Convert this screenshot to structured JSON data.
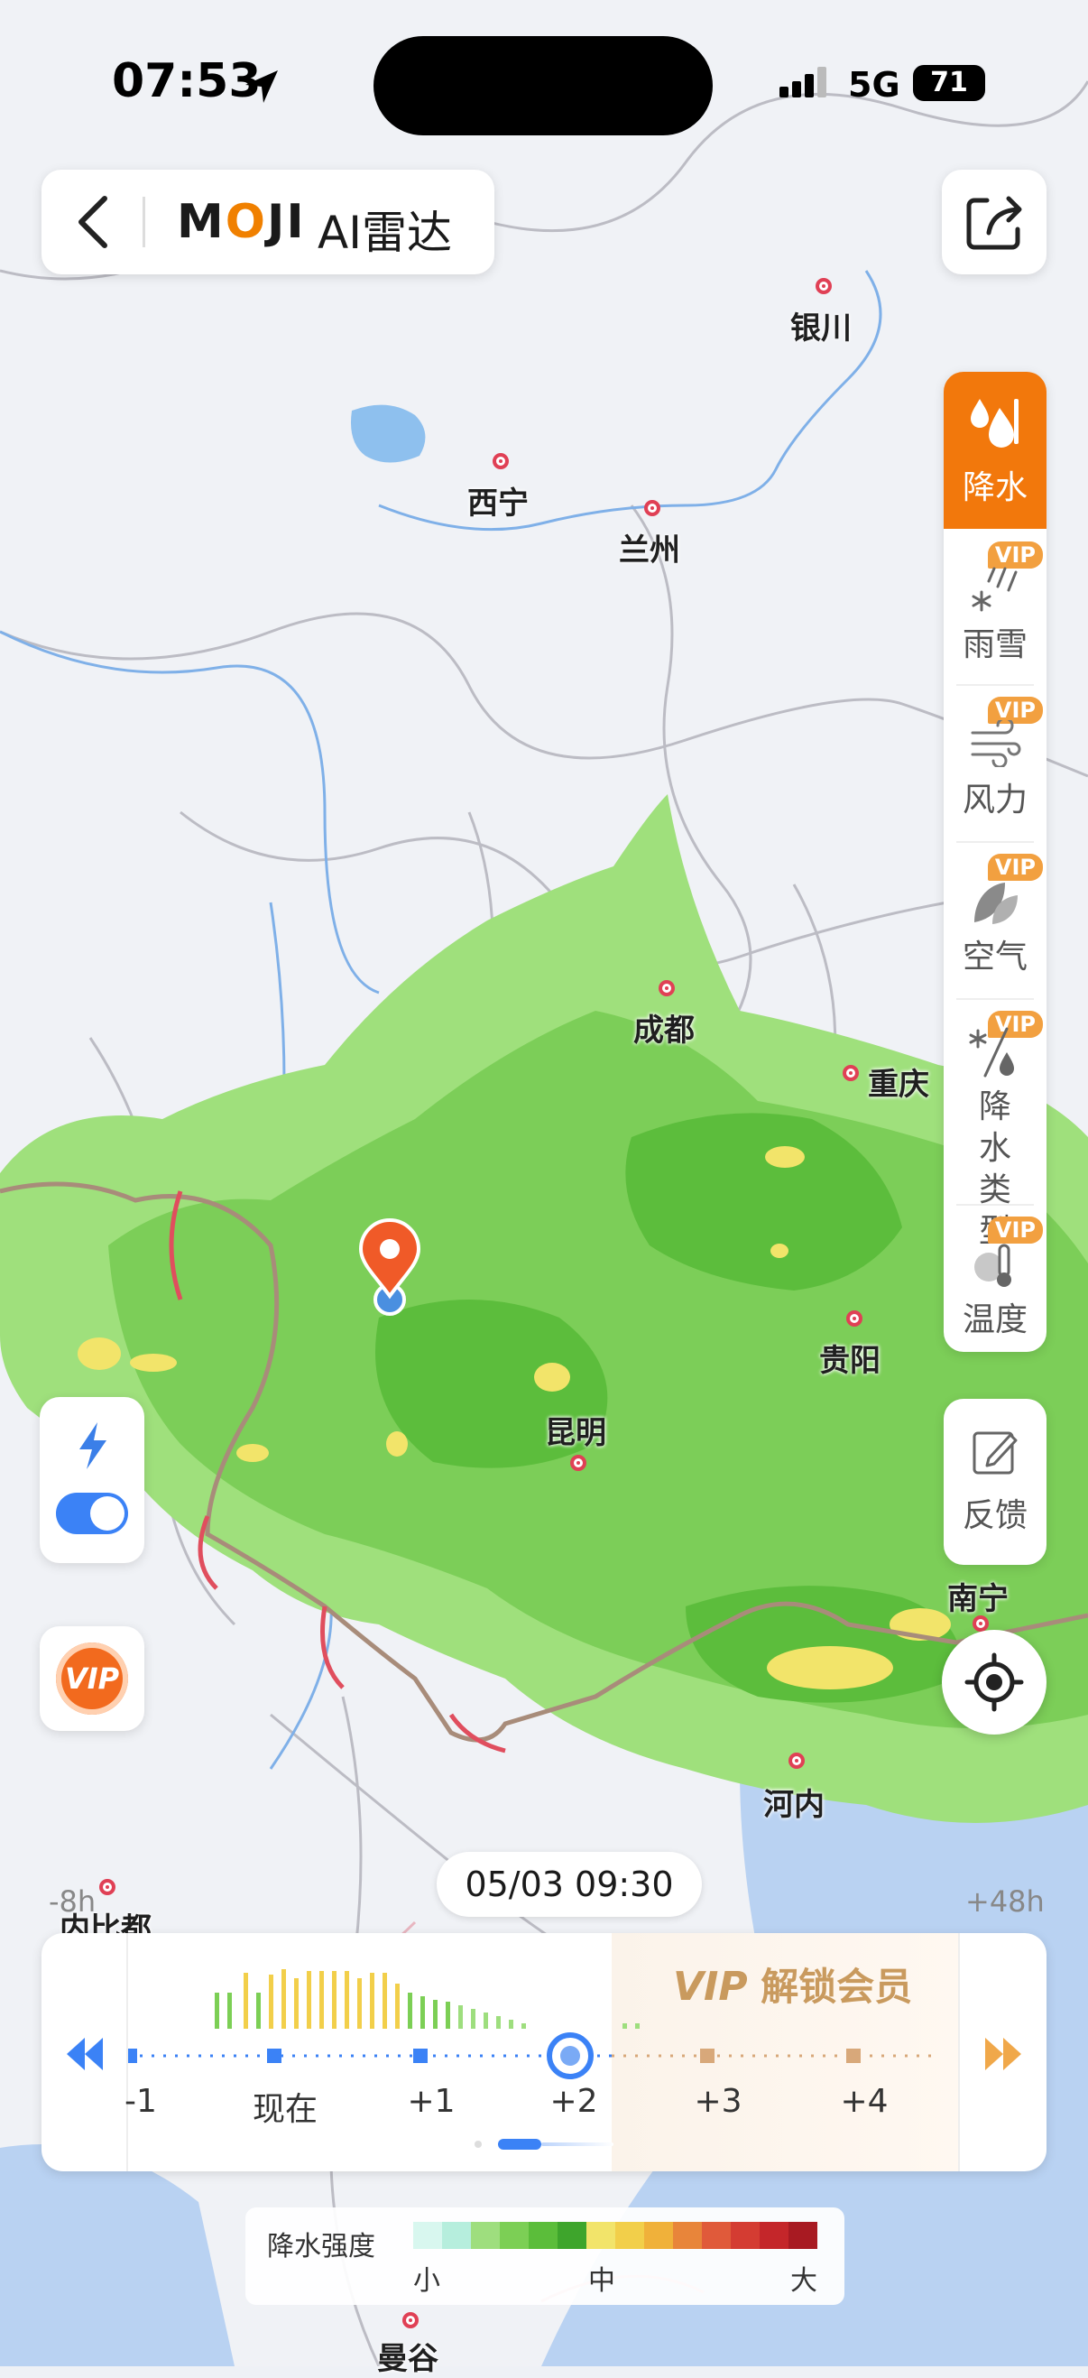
{
  "status_bar": {
    "time": "07:53",
    "network": "5G",
    "battery": "71"
  },
  "header": {
    "brand": "MOJI",
    "title": "AI雷达"
  },
  "cities": [
    {
      "name": "银川"
    },
    {
      "name": "西宁"
    },
    {
      "name": "兰州"
    },
    {
      "name": "成都"
    },
    {
      "name": "重庆"
    },
    {
      "name": "贵阳"
    },
    {
      "name": "昆明"
    },
    {
      "name": "南宁"
    },
    {
      "name": "河内"
    },
    {
      "name": "内比都"
    },
    {
      "name": "曼谷"
    }
  ],
  "layers": [
    {
      "label": "降水",
      "vip": "",
      "icon": "rain-drops-icon",
      "active": true
    },
    {
      "label": "雨雪",
      "vip": "VIP",
      "icon": "rain-snow-icon",
      "active": false
    },
    {
      "label": "风力",
      "vip": "VIP",
      "icon": "wind-icon",
      "active": false
    },
    {
      "label": "空气",
      "vip": "VIP",
      "icon": "leaf-icon",
      "active": false
    },
    {
      "label": "降水类型",
      "vip": "VIP",
      "icon": "precip-type-icon",
      "active": false
    },
    {
      "label": "温度",
      "vip": "VIP",
      "icon": "thermometer-icon",
      "active": false
    }
  ],
  "feedback": {
    "label": "反馈"
  },
  "vip_button": {
    "label": "VIP"
  },
  "timeline": {
    "date": "05/03 09:30",
    "left_edge": "-8h",
    "right_edge": "+48h",
    "vip_unlock_prefix": "VIP",
    "vip_unlock_text": "解锁会员",
    "ticks": [
      "-1",
      "现在",
      "+1",
      "+2",
      "+3",
      "+4"
    ]
  },
  "legend": {
    "title": "降水强度",
    "low": "小",
    "mid": "中",
    "high": "大",
    "colors": [
      "#d8f7ef",
      "#b6eedd",
      "#9ede7e",
      "#7ccf55",
      "#5bbd3a",
      "#3ea52c",
      "#f2e46a",
      "#f2cf4a",
      "#f0b13a",
      "#e8853a",
      "#e05a3a",
      "#d43c32",
      "#c4262a",
      "#a81a22"
    ]
  },
  "colors": {
    "accent": "#f2780c",
    "timeline_blue": "#3b82f6",
    "vip_gold": "#c99a5e",
    "rain_green": "#8fd86a"
  }
}
